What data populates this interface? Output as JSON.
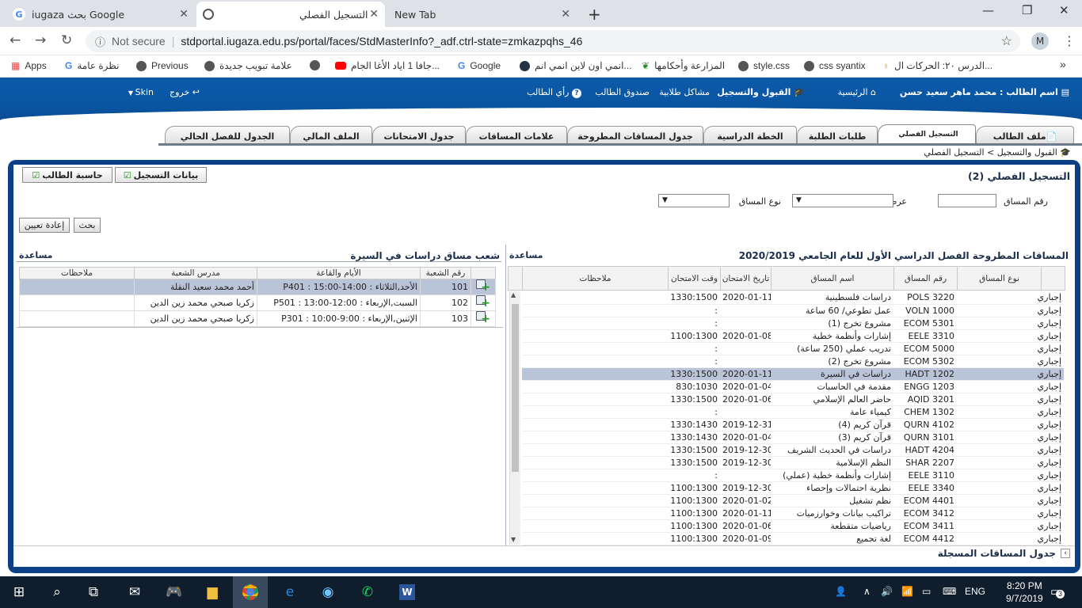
{
  "browser": {
    "tabs": [
      {
        "title": "iugaza بحث Google"
      },
      {
        "title": "التسجيل الفصلي"
      },
      {
        "title": "New Tab"
      }
    ],
    "new_tab": "+",
    "not_secure": "Not secure",
    "url": "stdportal.iugaza.edu.ps/portal/faces/StdMasterInfo?_adf.ctrl-state=zmkazpqhs_46",
    "profile": "M",
    "bookmarks": [
      "Apps",
      "نظرة عامة",
      "Previous",
      "علامة تبويب جديدة",
      "",
      "جافا 1 اياد الأغا الجام...",
      "Google",
      "انمي اون لاين انمي انم...",
      "المزارعة وأحكامها",
      "style.css",
      "css syantix",
      "الدرس ٢٠: الحركات ال..."
    ],
    "more": "»"
  },
  "header": {
    "student_name": "اسم الطالب : محمد ماهر سعيد حسن",
    "home": "الرئيسية",
    "admission": "القبول والتسجيل",
    "student_issues": "مشاكل طلابية",
    "student_box": "صندوق الطالب",
    "student_opinion": "رأي الطالب",
    "logout": "خروج",
    "skin": "Skin"
  },
  "tabs": [
    {
      "label": "ملف الطالب"
    },
    {
      "label": "التسجيل الفصلي"
    },
    {
      "label": "طلبات الطلبة"
    },
    {
      "label": "الخطة الدراسية"
    },
    {
      "label": "جدول المساقات المطروحة"
    },
    {
      "label": "علامات المساقات"
    },
    {
      "label": "جدول الامتحانات"
    },
    {
      "label": "الملف المالي"
    },
    {
      "label": "الجدول للفصل الحالي"
    }
  ],
  "breadcrumb": "القبول والتسجيل > التسجيل الفصلي",
  "page": {
    "title": "التسجيل الفصلي (2)",
    "reg_data_btn": "بيانات التسجيل",
    "calc_btn": "حاسبة الطالب",
    "course_no_label": "رقم المساق",
    "view_label": "عرض",
    "course_type_label": "نوع المساق",
    "search_btn": "بحث",
    "reset_btn": "إعادة تعيين",
    "help": "مساعدة",
    "bottom_title": "جدول المساقات المسجلة"
  },
  "courses": {
    "title": "المساقات المطروحة الفصل الدراسي الأول للعام الجامعي 2020/2019",
    "columns": [
      "نوع المساق",
      "رقم المساق",
      "اسم المساق",
      "تاريخ الامتحان",
      "وقت الامتحان",
      "ملاحظات"
    ],
    "rows": [
      [
        "إجباري",
        "POLS 3220",
        "دراسات فلسطينية",
        "2020-01-11",
        "1330:1500",
        ""
      ],
      [
        "إجباري",
        "VOLN 1000",
        "عمل تطوعي/ 60 ساعة",
        "",
        ":",
        ""
      ],
      [
        "إجباري",
        "ECOM 5301",
        "مشروع تخرج (1)",
        "",
        ":",
        ""
      ],
      [
        "إجباري",
        "EELE 3310",
        "إشارات وأنظمة خطية",
        "2020-01-08",
        "1100:1300",
        ""
      ],
      [
        "إجباري",
        "ECOM 5000",
        "تدريب عملي (250 ساعة)",
        "",
        ":",
        ""
      ],
      [
        "إجباري",
        "ECOM 5302",
        "مشروع تخرج (2)",
        "",
        ":",
        ""
      ],
      [
        "إجباري",
        "HADT 1202",
        "دراسات في السيرة",
        "2020-01-11",
        "1330:1500",
        ""
      ],
      [
        "إجباري",
        "ENGG 1203",
        "مقدمة في الحاسبات",
        "2020-01-04",
        "830:1030",
        ""
      ],
      [
        "إجباري",
        "AQID 3201",
        "حاضر العالم الإسلامي",
        "2020-01-06",
        "1330:1500",
        ""
      ],
      [
        "إجباري",
        "CHEM 1302",
        "كيمياء عامة",
        "",
        ":",
        ""
      ],
      [
        "إجباري",
        "QURN 4102",
        "قرآن كريم (4)",
        "2019-12-31",
        "1330:1430",
        ""
      ],
      [
        "إجباري",
        "QURN 3101",
        "قرآن كريم (3)",
        "2020-01-04",
        "1330:1430",
        ""
      ],
      [
        "إجباري",
        "HADT 4204",
        "دراسات في الحديث الشريف",
        "2019-12-30",
        "1330:1500",
        ""
      ],
      [
        "إجباري",
        "SHAR 2207",
        "النظم الإسلامية",
        "2019-12-30",
        "1330:1500",
        ""
      ],
      [
        "إجباري",
        "EELE 3110",
        "إشارات وأنظمة خطية (عملي)",
        "",
        ":",
        ""
      ],
      [
        "إجباري",
        "EELE 3340",
        "نظرية احتمالات وإحصاء",
        "2019-12-30",
        "1100:1300",
        ""
      ],
      [
        "إجباري",
        "ECOM 4401",
        "نظم تشغيل",
        "2020-01-02",
        "1100:1300",
        ""
      ],
      [
        "إجباري",
        "ECOM 3412",
        "تراكيب بيانات وخوارزميات",
        "2020-01-11",
        "1100:1300",
        ""
      ],
      [
        "إجباري",
        "ECOM 3411",
        "رياضيات متقطعة",
        "2020-01-06",
        "1100:1300",
        ""
      ],
      [
        "إجباري",
        "ECOM 4412",
        "لغة تجميع",
        "2020-01-09",
        "1100:1300",
        ""
      ]
    ]
  },
  "sections": {
    "title": "شعب مساق دراسات في السيرة",
    "columns": [
      "رقم الشعبة",
      "الأيام والقاعة",
      "مدرس الشعبة",
      "ملاحظات"
    ],
    "rows": [
      [
        "101",
        "الأحد,الثلاثاء : 14:00-15:00 : P401",
        "أحمد محمد سعيد النقلة",
        ""
      ],
      [
        "102",
        "السبت,الإربعاء : 12:00-13:00 : P501",
        "زكريا صبحي محمد زين الدين",
        ""
      ],
      [
        "103",
        "الإثنين,الإربعاء : 9:00-10:00 : P301",
        "زكريا صبحي محمد زين الدين",
        ""
      ]
    ]
  },
  "taskbar": {
    "time": "8:20 PM",
    "date": "9/7/2019",
    "lang": "ENG",
    "notif_count": "3"
  }
}
